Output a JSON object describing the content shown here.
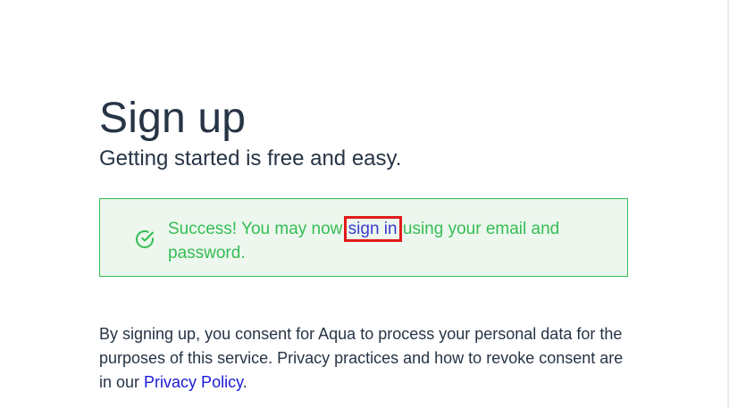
{
  "header": {
    "title": "Sign up",
    "subtitle": "Getting started is free and easy."
  },
  "alert": {
    "icon": "check-circle-icon",
    "prefix": "Success! You may now",
    "link_label": "sign in",
    "suffix": "using your email and password.",
    "color": "#35bd54",
    "background": "#edf7ee",
    "link_color": "#3b3bd1",
    "highlight_color": "#e01b1b"
  },
  "consent": {
    "text": "By signing up, you consent for Aqua to process your personal data for the purposes of this service. Privacy practices and how to revoke consent are in our",
    "link_label": "Privacy Policy",
    "suffix": "."
  }
}
